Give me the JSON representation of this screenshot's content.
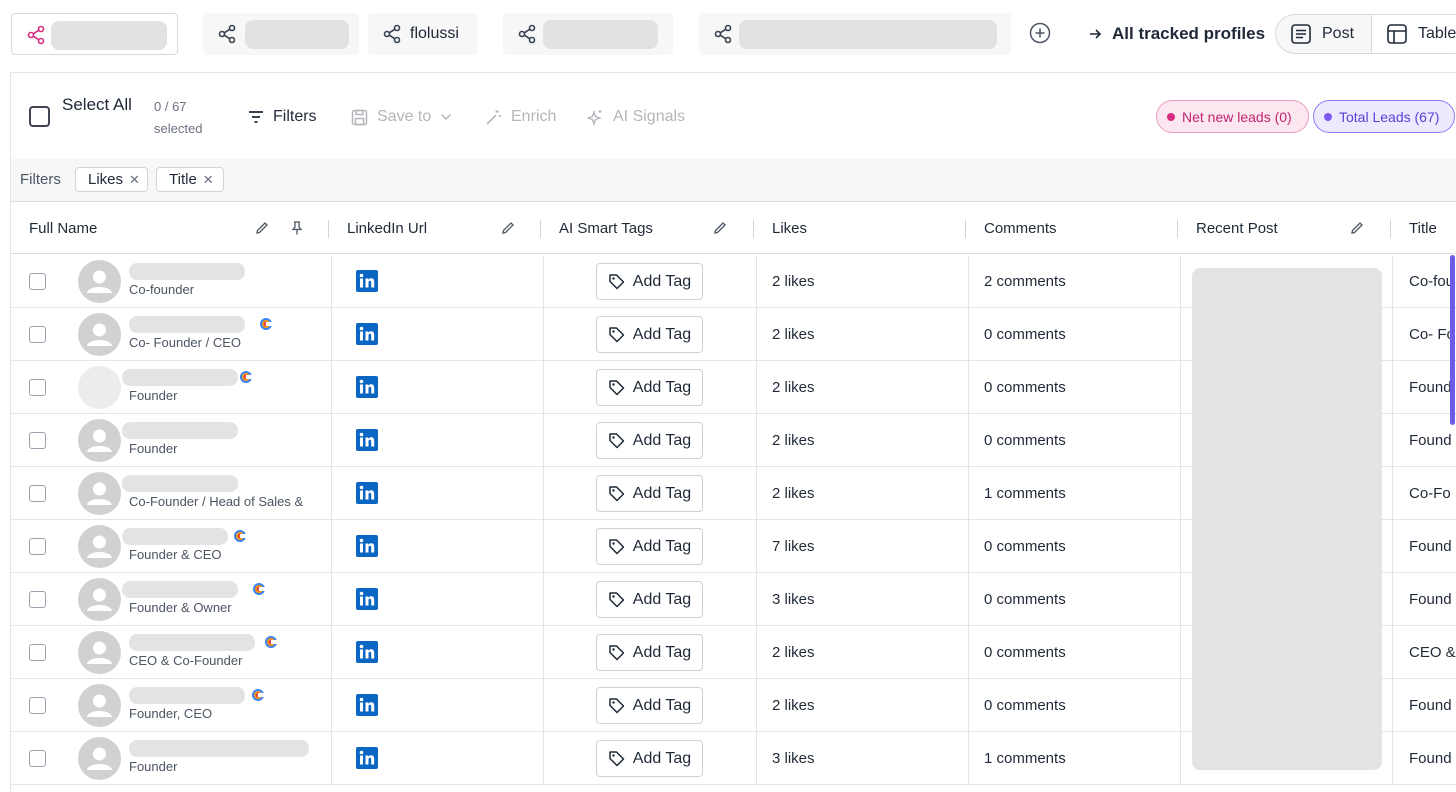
{
  "tabs": [
    {
      "label": "",
      "active": true
    },
    {
      "label": "",
      "active": false
    },
    {
      "label": "flolussi",
      "active": false
    },
    {
      "label": "",
      "active": false
    },
    {
      "label": "",
      "active": false
    }
  ],
  "header": {
    "all_tracked_label": "All tracked profiles",
    "view_post_label": "Post",
    "view_table_label": "Table"
  },
  "toolbar": {
    "select_all_label": "Select All",
    "selected_count": "0 / 67",
    "selected_suffix": "selected",
    "filters_label": "Filters",
    "save_label": "Save to",
    "enrich_label": "Enrich",
    "ai_signals_label": "AI Signals",
    "net_new_leads": "Net new leads (0)",
    "total_leads": "Total Leads (67)"
  },
  "filters": {
    "title": "Filters",
    "chips": [
      "Likes",
      "Title"
    ]
  },
  "table": {
    "columns": [
      "Full Name",
      "LinkedIn Url",
      "AI Smart Tags",
      "Likes",
      "Comments",
      "Recent Post",
      "Title"
    ],
    "add_tag_label": "Add Tag",
    "rows": [
      {
        "role": "Co-founder",
        "likes": "2 likes",
        "comments": "2 comments",
        "title": "Co-fou"
      },
      {
        "role": "Co- Founder / CEO",
        "likes": "2 likes",
        "comments": "0 comments",
        "title": "Co- Fo"
      },
      {
        "role": "Founder",
        "likes": "2 likes",
        "comments": "0 comments",
        "title": "Found"
      },
      {
        "role": "Founder",
        "likes": "2 likes",
        "comments": "0 comments",
        "title": "Found"
      },
      {
        "role": "Co-Founder / Head of Sales &",
        "likes": "2 likes",
        "comments": "1 comments",
        "title": "Co-Fo"
      },
      {
        "role": "Founder & CEO",
        "likes": "7 likes",
        "comments": "0 comments",
        "title": "Found"
      },
      {
        "role": "Founder & Owner",
        "likes": "3 likes",
        "comments": "0 comments",
        "title": "Found"
      },
      {
        "role": "CEO & Co-Founder",
        "likes": "2 likes",
        "comments": "0 comments",
        "title": "CEO &"
      },
      {
        "role": "Founder, CEO",
        "likes": "2 likes",
        "comments": "0 comments",
        "title": "Found"
      },
      {
        "role": "Founder",
        "likes": "3 likes",
        "comments": "1 comments",
        "title": "Found"
      }
    ]
  },
  "colors": {
    "accent_pink": "#d62d7e",
    "accent_purple": "#7c5cf0",
    "linkedin_blue": "#0a66c2"
  }
}
